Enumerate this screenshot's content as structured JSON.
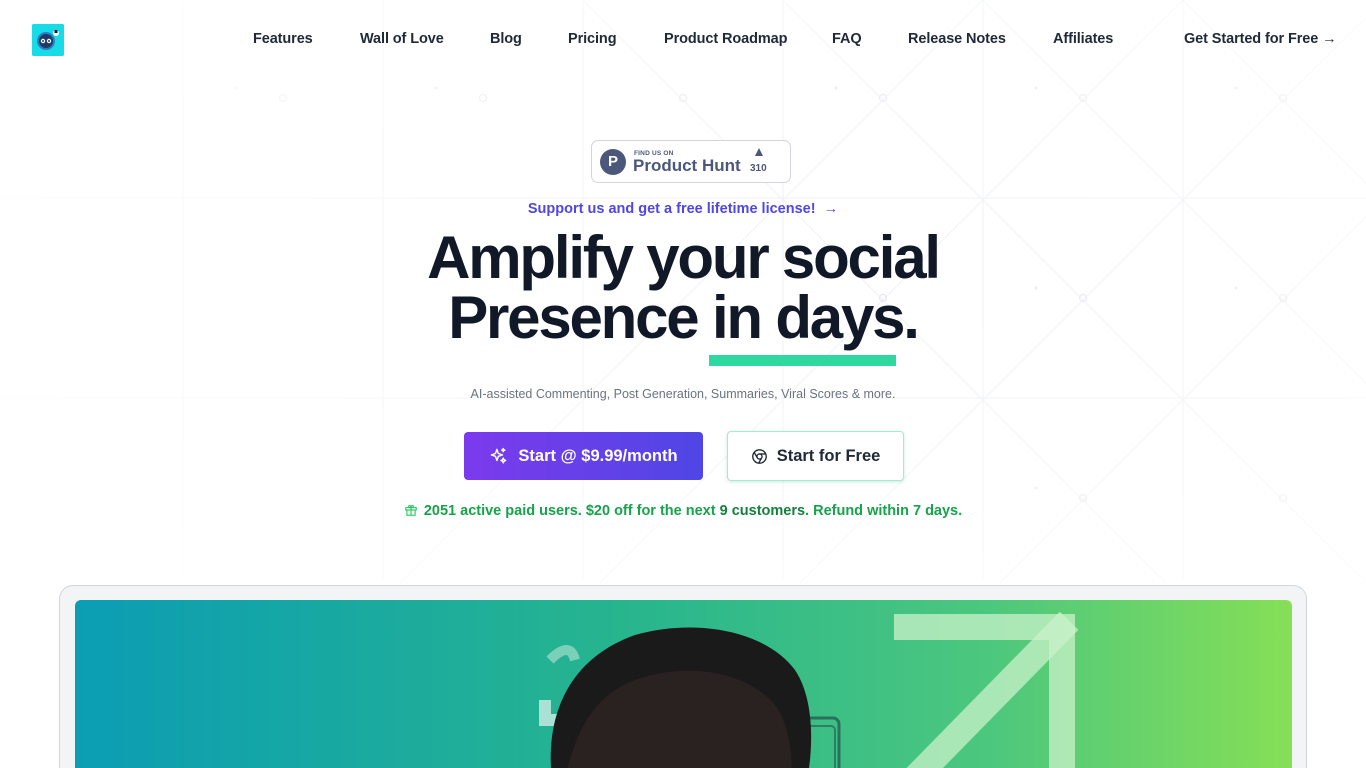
{
  "header": {
    "logo_alt": "robot-logo",
    "nav": [
      {
        "label": "Features"
      },
      {
        "label": "Wall of Love"
      },
      {
        "label": "Blog"
      },
      {
        "label": "Pricing"
      },
      {
        "label": "Product Roadmap"
      },
      {
        "label": "FAQ"
      },
      {
        "label": "Release Notes"
      },
      {
        "label": "Affiliates"
      }
    ],
    "cta_label": "Get Started for Free →"
  },
  "product_hunt": {
    "small_text": "FIND US ON",
    "name": "Product Hunt",
    "logo_letter": "P",
    "upvotes": "310"
  },
  "hero": {
    "support_text": "Support us and get a free lifetime license!",
    "support_arrow": "→",
    "headline_line1": "Amplify your social",
    "headline_line2_a": "Presence ",
    "headline_line2_b": "in days.",
    "subtext": "AI-assisted Commenting, Post Generation, Summaries, Viral Scores & more.",
    "primary_button": "Start @ $9.99/month",
    "secondary_button": "Start for Free",
    "promo_a": "2051 active paid users. $20 off for the next ",
    "promo_b": "9 customers",
    "promo_c": ". Refund within 7 days."
  },
  "colors": {
    "accent_purple": "#7c3aed",
    "accent_indigo": "#4f46e5",
    "underline_green": "#2ed89e",
    "promo_green": "#16a34a"
  },
  "icons": [
    "sparkles-icon",
    "chrome-icon",
    "gift-icon",
    "upvote-arrow-icon",
    "robot-logo-icon"
  ]
}
